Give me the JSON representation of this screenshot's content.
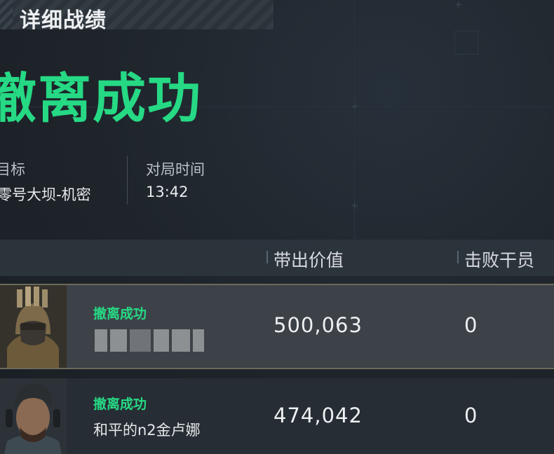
{
  "header": {
    "title": "详细战绩"
  },
  "result": {
    "title": "撤离成功"
  },
  "info": {
    "target_label": "目标",
    "target_value": "零号大坝-机密",
    "time_label": "对局时间",
    "time_value": "13:42"
  },
  "table": {
    "columns": [
      "带出价值",
      "击败干员"
    ],
    "rows": [
      {
        "status": "撤离成功",
        "name": "",
        "value": "500,063",
        "kills": "0",
        "name_blurred": true
      },
      {
        "status": "撤离成功",
        "name": "和平的n2金卢娜",
        "value": "474,042",
        "kills": "0",
        "name_blurred": false
      }
    ]
  },
  "colors": {
    "accent": "#26d984",
    "background": "#1f252b",
    "highlight_row": "#3d4248"
  }
}
